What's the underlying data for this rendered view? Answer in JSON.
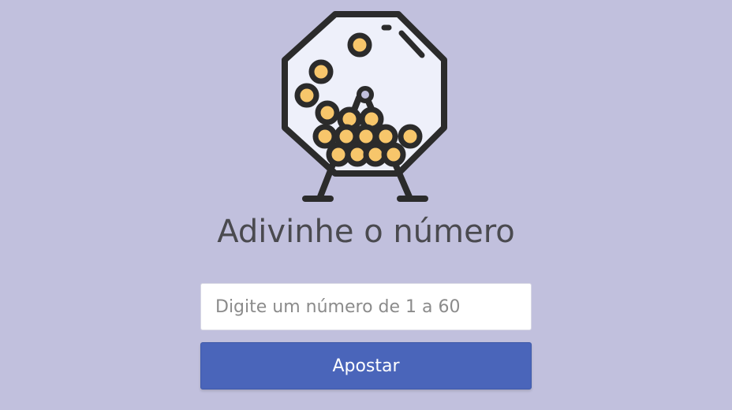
{
  "colors": {
    "background": "#c1c0dd",
    "title": "#4a4a4f",
    "button": "#4a65ba",
    "button_text": "#ffffff",
    "ball": "#f7c66b",
    "outline": "#2b2b2b",
    "drum_fill": "#eef0fa"
  },
  "illustration": {
    "icon": "lottery-drum-icon"
  },
  "header": {
    "title": "Adivinhe o número"
  },
  "form": {
    "input_placeholder": "Digite um número de 1 a 60",
    "input_value": "",
    "submit_label": "Apostar"
  }
}
